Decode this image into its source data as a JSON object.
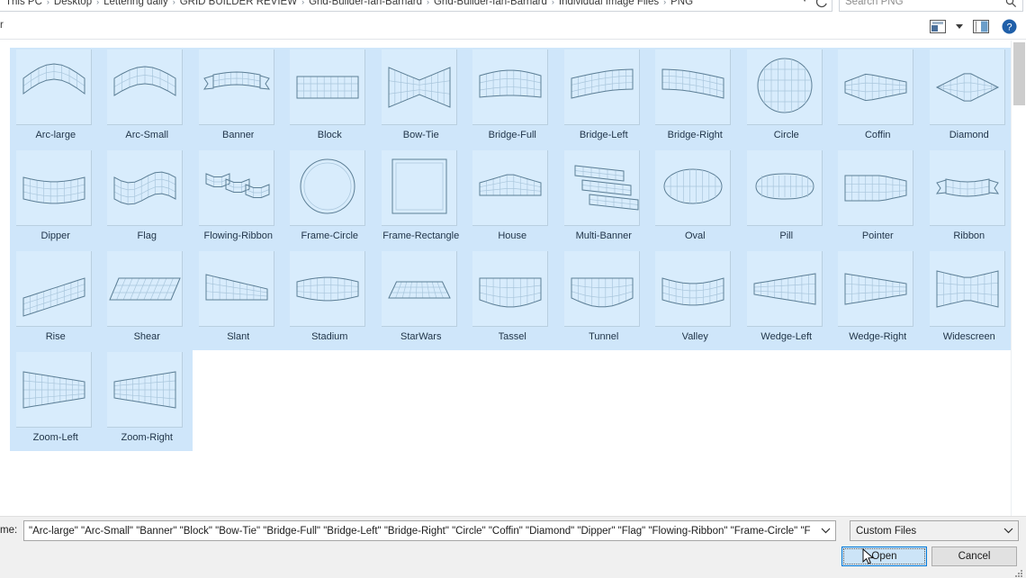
{
  "window": {
    "breadcrumb": [
      "This PC",
      "Desktop",
      "Lettering daily",
      "GRID BUILDER REVIEW",
      "Grid-Builder-Ian-Barnard",
      "Grid-Builder-Ian-Barnard",
      "Individual Image Files",
      "PNG"
    ],
    "breadcrumb_separator": "›",
    "search_placeholder": "Search PNG",
    "refresh_icon": "refresh-icon",
    "search_icon": "search-icon",
    "breadcrumb_dropdown_icon": "chevron-down-icon"
  },
  "toolbar": {
    "organize_label": "r",
    "view_icon": "view-layout-icon",
    "view_dropdown_icon": "chevron-down-icon",
    "preview_pane_icon": "preview-pane-icon",
    "help_icon": "help-icon"
  },
  "files": {
    "items": [
      {
        "label": "Arc-large",
        "shape": "arc-large"
      },
      {
        "label": "Arc-Small",
        "shape": "arc-small"
      },
      {
        "label": "Banner",
        "shape": "banner"
      },
      {
        "label": "Block",
        "shape": "block"
      },
      {
        "label": "Bow-Tie",
        "shape": "bow-tie"
      },
      {
        "label": "Bridge-Full",
        "shape": "bridge-full"
      },
      {
        "label": "Bridge-Left",
        "shape": "bridge-left"
      },
      {
        "label": "Bridge-Right",
        "shape": "bridge-right"
      },
      {
        "label": "Circle",
        "shape": "circle"
      },
      {
        "label": "Coffin",
        "shape": "coffin"
      },
      {
        "label": "Diamond",
        "shape": "diamond"
      },
      {
        "label": "Dipper",
        "shape": "dipper"
      },
      {
        "label": "Flag",
        "shape": "flag"
      },
      {
        "label": "Flowing-Ribbon",
        "shape": "flowing-ribbon"
      },
      {
        "label": "Frame-Circle",
        "shape": "frame-circle"
      },
      {
        "label": "Frame-Rectangle",
        "shape": "frame-rectangle"
      },
      {
        "label": "House",
        "shape": "house"
      },
      {
        "label": "Multi-Banner",
        "shape": "multi-banner"
      },
      {
        "label": "Oval",
        "shape": "oval"
      },
      {
        "label": "Pill",
        "shape": "pill"
      },
      {
        "label": "Pointer",
        "shape": "pointer"
      },
      {
        "label": "Ribbon",
        "shape": "ribbon"
      },
      {
        "label": "Rise",
        "shape": "rise"
      },
      {
        "label": "Shear",
        "shape": "shear"
      },
      {
        "label": "Slant",
        "shape": "slant"
      },
      {
        "label": "Stadium",
        "shape": "stadium"
      },
      {
        "label": "StarWars",
        "shape": "starwars"
      },
      {
        "label": "Tassel",
        "shape": "tassel"
      },
      {
        "label": "Tunnel",
        "shape": "tunnel"
      },
      {
        "label": "Valley",
        "shape": "valley"
      },
      {
        "label": "Wedge-Left",
        "shape": "wedge-left"
      },
      {
        "label": "Wedge-Right",
        "shape": "wedge-right"
      },
      {
        "label": "Widescreen",
        "shape": "widescreen"
      },
      {
        "label": "Zoom-Left",
        "shape": "zoom-left"
      },
      {
        "label": "Zoom-Right",
        "shape": "zoom-right"
      }
    ]
  },
  "footer": {
    "filename_label": "me:",
    "filename_value": "\"Arc-large\" \"Arc-Small\" \"Banner\" \"Block\" \"Bow-Tie\" \"Bridge-Full\" \"Bridge-Left\" \"Bridge-Right\" \"Circle\" \"Coffin\" \"Diamond\" \"Dipper\" \"Flag\" \"Flowing-Ribbon\" \"Frame-Circle\" \"F",
    "filter_value": "Custom Files",
    "open_label": "Open",
    "cancel_label": "Cancel",
    "filename_dropdown_icon": "chevron-down-icon",
    "filter_dropdown_icon": "chevron-down-icon",
    "resize_grip_icon": "resize-grip-icon",
    "cursor_icon": "mouse-pointer-icon"
  },
  "colors": {
    "selection_bg": "#cfe6fa",
    "thumb_bg": "#d8ecfc",
    "accent": "#0078d7",
    "label_text": "#1f3347"
  }
}
